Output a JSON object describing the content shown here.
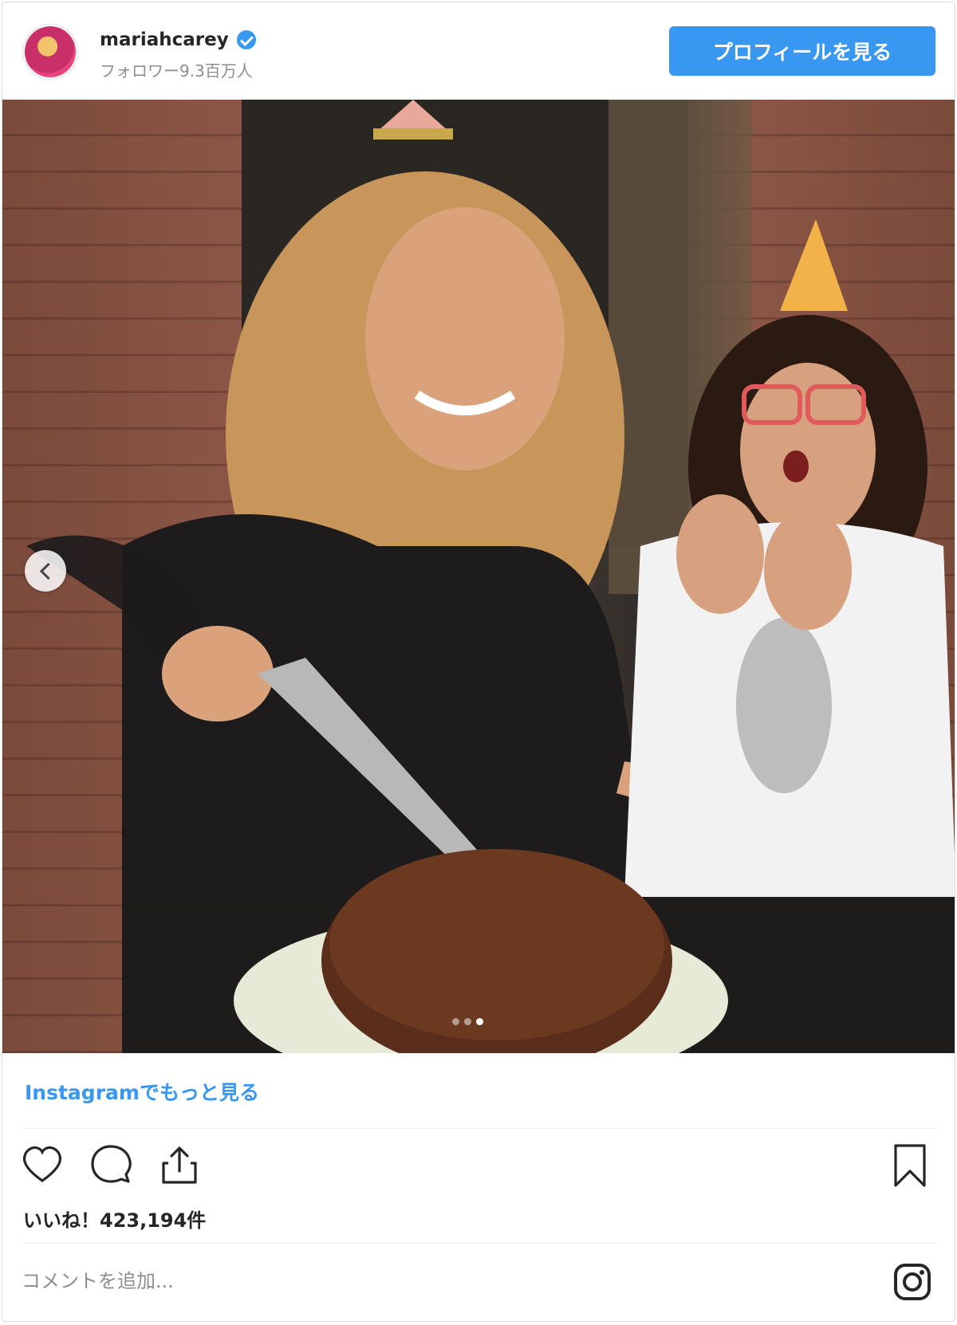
{
  "header": {
    "username": "mariahcarey",
    "followers": "フォロワー9.3百万人",
    "profile_button": "プロフィールを見る"
  },
  "photo": {
    "carousel_dots": 3,
    "active_dot": 2,
    "colors": {
      "brick": "#8c5646",
      "cake": "#5a2e1a",
      "hair": "#c8965a"
    }
  },
  "footer": {
    "more_link": "Instagramでもっと見る",
    "likes": "いいね！423,194件",
    "comment_placeholder": "コメントを追加..."
  },
  "icons": [
    "heart-icon",
    "comment-icon",
    "share-icon",
    "bookmark-icon",
    "instagram-icon",
    "chevron-left-icon",
    "verified-icon"
  ],
  "accent_color": "#3897f0"
}
